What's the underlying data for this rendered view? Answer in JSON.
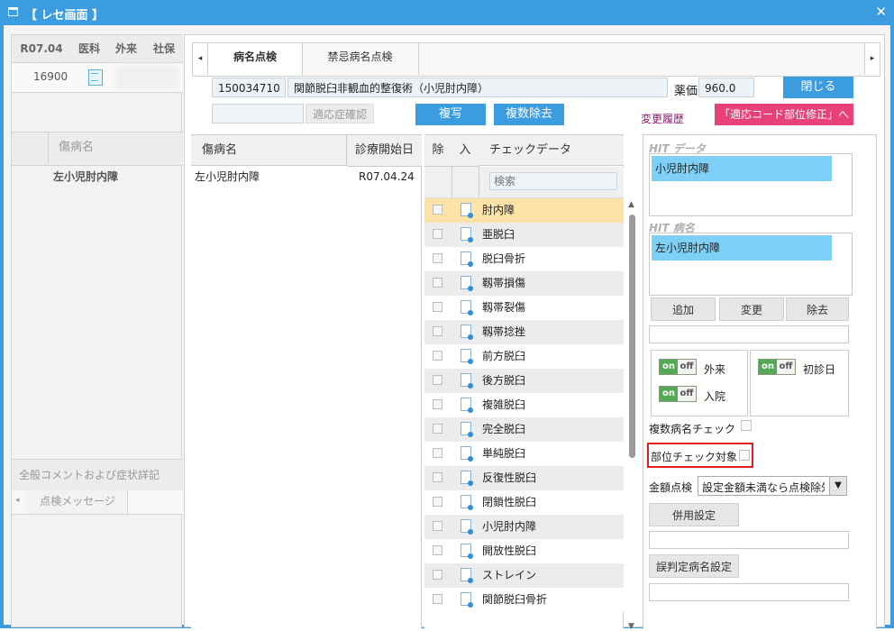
{
  "window": {
    "title": "【 レセ画面 】"
  },
  "left": {
    "header": [
      "R07.04",
      "医科",
      "外来",
      "社保"
    ],
    "number": "16900",
    "disease_col": "傷病名",
    "disease": "左小児肘内障",
    "comment_section": "全般コメントおよび症状詳記",
    "message_tab": "点検メッセージ"
  },
  "tabs": [
    "病名点検",
    "禁忌病名点検"
  ],
  "code": "150034710",
  "procedure_name": "関節脱臼非観血的整復術（小児肘内障）",
  "price_label": "薬価",
  "price_value": "960.0",
  "buttons": {
    "close": "閉じる",
    "indication_check": "適応症確認",
    "copy": "複写",
    "multi_remove": "複数除去",
    "change_history": "変更履歴",
    "fix_code": "「適応コード部位修正」へ",
    "add": "追加",
    "change": "変更",
    "remove": "除去",
    "combined_setting": "併用設定",
    "misjudge_setting": "誤判定病名設定"
  },
  "disease_table": {
    "headers": [
      "傷病名",
      "診療開始日"
    ],
    "rows": [
      {
        "name": "左小児肘内障",
        "date": "R07.04.24"
      }
    ]
  },
  "check_table": {
    "headers": [
      "除",
      "入",
      "チェックデータ"
    ],
    "search_placeholder": "検索",
    "rows": [
      "肘内障",
      "亜脱臼",
      "脱臼骨折",
      "靱帯損傷",
      "靱帯裂傷",
      "靱帯捻挫",
      "前方脱臼",
      "後方脱臼",
      "複雑脱臼",
      "完全脱臼",
      "単純脱臼",
      "反復性脱臼",
      "閉鎖性脱臼",
      "小児肘内障",
      "開放性脱臼",
      "ストレイン",
      "関節脱臼骨折"
    ]
  },
  "side": {
    "hit_data_title": "HIT データ",
    "hit_data_item": "小児肘内障",
    "hit_disease_title": "HIT 病名",
    "hit_disease_item": "左小児肘内障",
    "toggle_on": "on",
    "toggle_off": "off",
    "outpatient": "外来",
    "inpatient": "入院",
    "first_visit": "初診日",
    "multi_disease_check": "複数病名チェック",
    "site_check_target": "部位チェック対象",
    "amount_check_label": "金額点検",
    "amount_check_value": "設定金額未満なら点検除外"
  },
  "colors": {
    "accent": "#3b9de0",
    "pink": "#e8407a",
    "highlight": "#7fd0f6",
    "row_selected": "#fde3a7",
    "alert_border": "#e02020"
  }
}
